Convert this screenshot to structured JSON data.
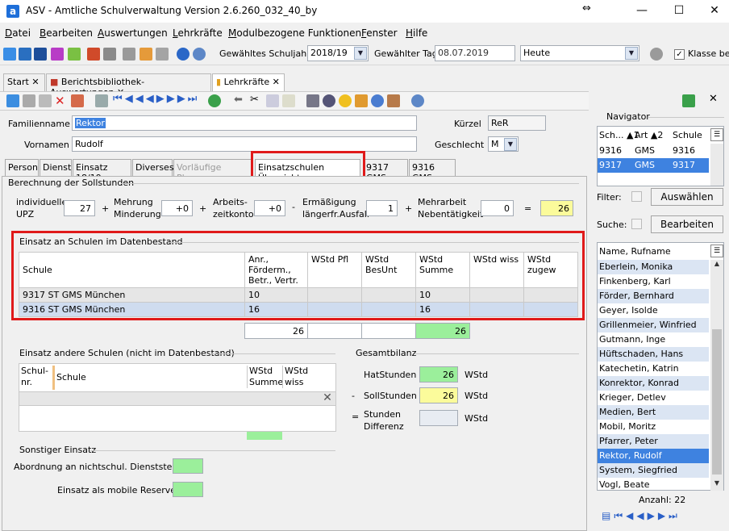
{
  "window": {
    "title": "ASV - Amtliche Schulverwaltung Version 2.6.260_032_40_by",
    "app_icon": "a",
    "move_icon": "⇔"
  },
  "menu": [
    "Datei",
    "Bearbeiten",
    "Auswertungen",
    "Lehrkräfte",
    "Modulbezogene Funktionen",
    "Fenster",
    "Hilfe"
  ],
  "toolbar": {
    "schuljahr_label": "Gewähltes Schuljahr",
    "schuljahr_value": "2018/19",
    "tag_label": "Gewählter Tag",
    "tag_value": "08.07.2019",
    "heute_value": "Heute",
    "klasse_label": "Klasse beib"
  },
  "doc_tabs": [
    {
      "label": "Start"
    },
    {
      "label": "Berichtsbibliothek-Auswertungen"
    },
    {
      "label": "Lehrkräfte"
    }
  ],
  "person": {
    "familienname_label": "Familienname",
    "familienname": "Rektor",
    "vornamen_label": "Vornamen",
    "vornamen": "Rudolf",
    "kuerzel_label": "Kürzel",
    "kuerzel": "ReR",
    "geschlecht_label": "Geschlecht",
    "geschlecht": "M"
  },
  "sub_tabs": [
    "Person",
    "Dienst",
    "Einsatz 18/19",
    "Diverses",
    "Vorläufige Planung",
    "Einsatzschulen Übersicht",
    "9317 GMS",
    "9316 GMS"
  ],
  "soll": {
    "title": "Berechnung der Sollstunden",
    "upz_label1": "individuelle",
    "upz_label2": "UPZ",
    "upz": "27",
    "mehr_label1": "Mehrung",
    "mehr_label2": "Minderung",
    "mehr": "+0",
    "arbeit_label1": "Arbeits-",
    "arbeit_label2": "zeitkonto",
    "arbeit": "+0",
    "erm_label1": "Ermäßigung",
    "erm_label2": "längerfr.Ausfall",
    "erm": "1",
    "mehrarbeit_label1": "Mehrarbeit",
    "mehrarbeit_label2": "Nebentätigkeit",
    "mehrarbeit": "0",
    "result": "26",
    "plus": "+",
    "minus": "-",
    "equals": "="
  },
  "einsatz_db": {
    "title": "Einsatz an Schulen im Datenbestand",
    "headers": [
      "Schule",
      "Anr., Förderm., Betr., Vertr.",
      "WStd Pfl",
      "WStd BesUnt",
      "WStd Summe",
      "WStd wiss",
      "WStd zugew"
    ],
    "rows": [
      [
        "9317 ST GMS München",
        "10",
        "",
        "",
        "10",
        "",
        ""
      ],
      [
        "9316 ST GMS München",
        "16",
        "",
        "",
        "16",
        "",
        ""
      ]
    ],
    "totals": [
      "26",
      "",
      "",
      "26"
    ]
  },
  "einsatz_andere": {
    "title": "Einsatz andere Schulen (nicht im Datenbestand)",
    "headers": [
      "Schul- nr.",
      "Schule",
      "WStd Summe",
      "WStd wiss"
    ],
    "delete_icon": "✕"
  },
  "gesamt": {
    "title": "Gesamtbilanz",
    "hat_label": "HatStunden",
    "hat_value": "26",
    "hat_unit": "WStd",
    "soll_prefix": "-",
    "soll_label": "SollStunden",
    "soll_value": "26",
    "soll_unit": "WStd",
    "diff_prefix": "=",
    "diff_label1": "Stunden",
    "diff_label2": "Differenz",
    "diff_value": "",
    "diff_unit": "WStd"
  },
  "sonstiger": {
    "title": "Sonstiger Einsatz",
    "abordnung_label": "Abordnung an nichtschul. Dienststelle",
    "mobile_label": "Einsatz als mobile Reserve"
  },
  "navigator": {
    "title": "Navigator",
    "headers": [
      "Sch... ▲1",
      "Art ▲2",
      "Schule"
    ],
    "rows": [
      [
        "9316",
        "GMS",
        "9316"
      ],
      [
        "9317",
        "GMS",
        "9317"
      ]
    ],
    "filter_label": "Filter:",
    "filter_button": "Auswählen",
    "suche_label": "Suche:",
    "suche_button": "Bearbeiten",
    "list_header": "Name, Rufname",
    "names": [
      "Eberlein, Monika",
      "Finkenberg, Karl",
      "Förder, Bernhard",
      "Geyer, Isolde",
      "Grillenmeier, Winfried",
      "Gutmann, Inge",
      "Hüftschaden, Hans",
      "Katechetin, Katrin",
      "Konrektor, Konrad",
      "Krieger, Detlev",
      "Medien, Bert",
      "Mobil, Moritz",
      "Pfarrer, Peter",
      "Rektor, Rudolf",
      "System, Siegfried",
      "Vogl, Beate"
    ],
    "selected_index": 13,
    "count_text": "Anzahl: 22"
  },
  "colors": {
    "highlight": "#e01a1a",
    "green": "#9bef9b",
    "yellow": "#fbfb9b",
    "selection": "#3e82e0"
  }
}
